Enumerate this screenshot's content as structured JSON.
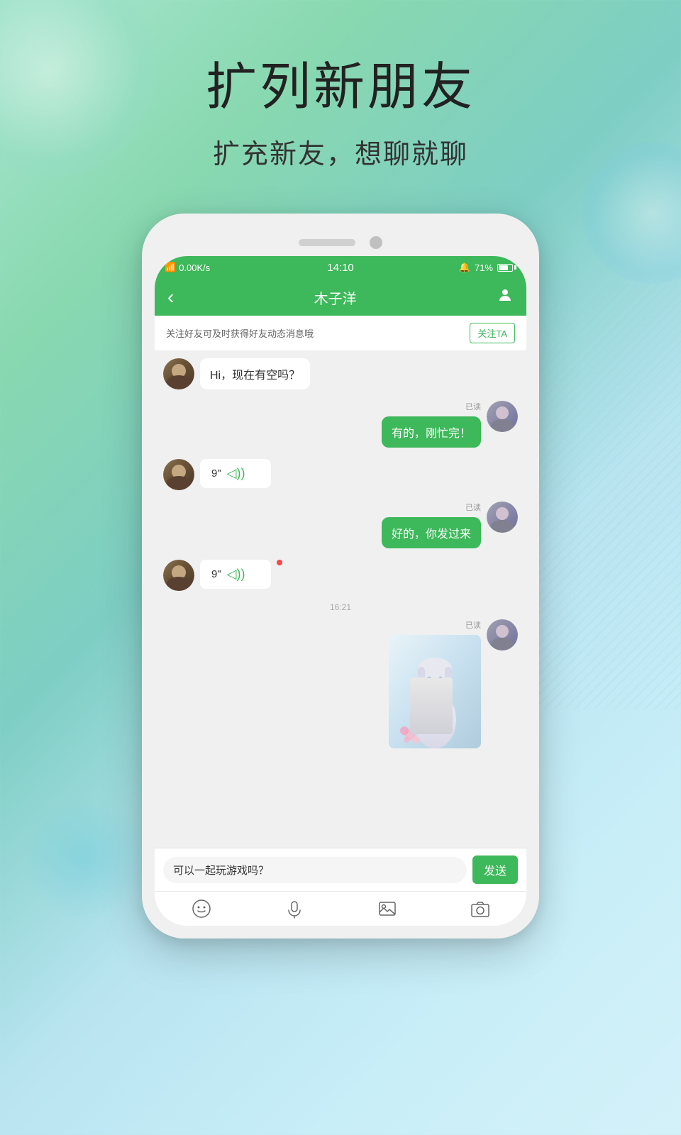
{
  "page": {
    "background": "gradient-teal-blue",
    "title_main": "扩列新朋友",
    "title_sub": "扩充新友，想聊就聊"
  },
  "phone": {
    "status_bar": {
      "left": "0.00K/s",
      "time": "14:10",
      "right_bell": "🔔",
      "battery_percent": "71%"
    },
    "nav": {
      "back_label": "‹",
      "title": "木子洋",
      "profile_icon": "👤"
    },
    "follow_banner": {
      "text": "关注好友可及时获得好友动态消息哦",
      "button": "关注TA"
    },
    "messages": [
      {
        "id": "msg1",
        "side": "left",
        "type": "text",
        "text": "Hi，现在有空吗？"
      },
      {
        "id": "msg2",
        "side": "right",
        "type": "text",
        "text": "有的，刚忙完！",
        "read": "已读"
      },
      {
        "id": "msg3",
        "side": "left",
        "type": "voice",
        "duration": "9\"",
        "waves": "◁))"
      },
      {
        "id": "msg4",
        "side": "right",
        "type": "text",
        "text": "好的，你发过来",
        "read": "已读"
      },
      {
        "id": "msg5",
        "side": "left",
        "type": "voice",
        "duration": "9\"",
        "waves": "◁))",
        "has_dot": true
      },
      {
        "id": "time1",
        "type": "divider",
        "text": "16:21"
      },
      {
        "id": "msg6",
        "side": "right",
        "type": "image",
        "read": "已读"
      }
    ],
    "input": {
      "placeholder": "可以一起玩游戏吗？",
      "value": "可以一起玩游戏吗？",
      "send_label": "发送"
    },
    "toolbar": {
      "icons": [
        "😊",
        "🎤",
        "🖼",
        "📷"
      ]
    }
  }
}
